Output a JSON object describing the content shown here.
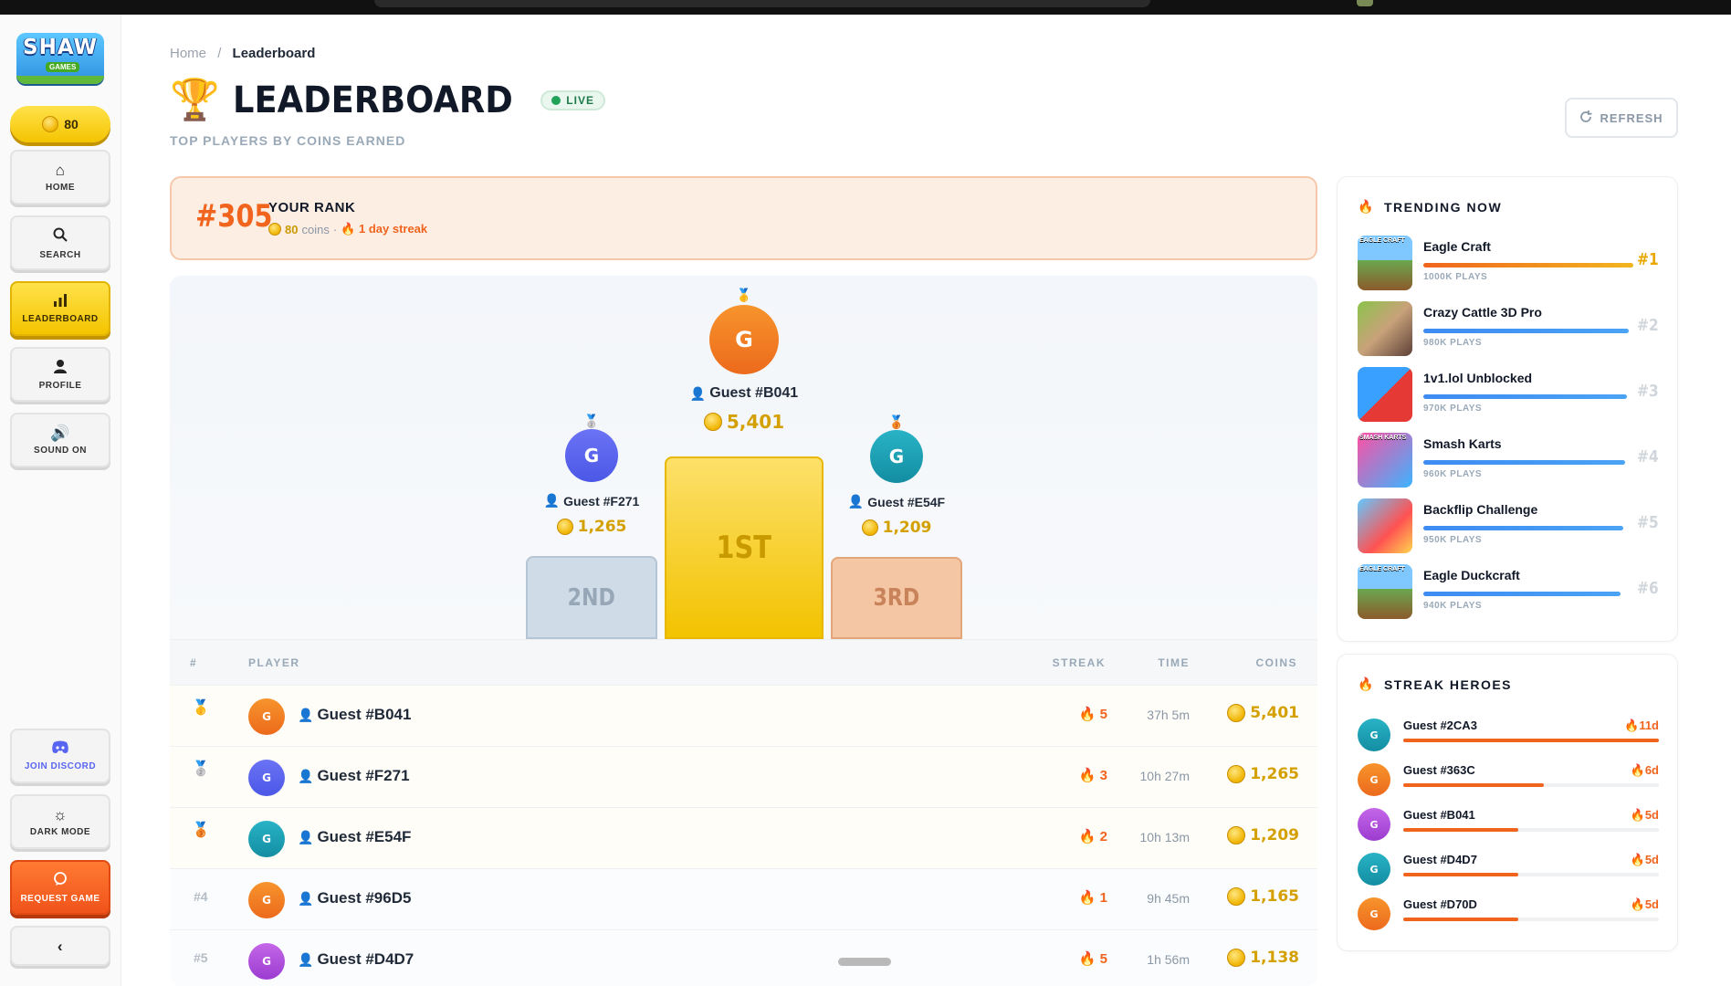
{
  "app": {
    "logo_text": "SHAW",
    "logo_sub": "GAMES",
    "coins": "80"
  },
  "sidebar": {
    "items": [
      {
        "label": "HOME",
        "icon": "home-icon"
      },
      {
        "label": "SEARCH",
        "icon": "search-icon"
      },
      {
        "label": "LEADERBOARD",
        "icon": "bar-chart-icon",
        "active": true
      },
      {
        "label": "PROFILE",
        "icon": "user-icon"
      },
      {
        "label": "SOUND ON",
        "icon": "speaker-icon"
      }
    ],
    "bottom": [
      {
        "label": "JOIN DISCORD",
        "icon": "discord-icon"
      },
      {
        "label": "DARK MODE",
        "icon": "sun-icon"
      },
      {
        "label": "REQUEST GAME",
        "icon": "chat-icon"
      }
    ],
    "collapse_glyph": "‹"
  },
  "breadcrumb": {
    "home": "Home",
    "separator": "/",
    "current": "Leaderboard"
  },
  "header": {
    "title": "LEADERBOARD",
    "live": "LIVE",
    "subtitle": "TOP PLAYERS BY COINS EARNED",
    "refresh": "REFRESH"
  },
  "your_rank": {
    "rank": "#305",
    "label": "YOUR RANK",
    "coins": "80",
    "coins_suffix": "coins",
    "separator": "·",
    "streak": "1 day streak"
  },
  "podium": {
    "first": {
      "initial": "G",
      "name": "Guest #B041",
      "coins": "5,401",
      "place": "1ST"
    },
    "second": {
      "initial": "G",
      "name": "Guest #F271",
      "coins": "1,265",
      "place": "2ND"
    },
    "third": {
      "initial": "G",
      "name": "Guest #E54F",
      "coins": "1,209",
      "place": "3RD"
    }
  },
  "table": {
    "headers": {
      "rank": "#",
      "player": "PLAYER",
      "streak": "STREAK",
      "time": "TIME",
      "coins": "COINS"
    },
    "rows": [
      {
        "rank": "1",
        "initial": "G",
        "name": "Guest #B041",
        "streak": "5",
        "time": "37h 5m",
        "coins": "5,401"
      },
      {
        "rank": "2",
        "initial": "G",
        "name": "Guest #F271",
        "streak": "3",
        "time": "10h 27m",
        "coins": "1,265"
      },
      {
        "rank": "3",
        "initial": "G",
        "name": "Guest #E54F",
        "streak": "2",
        "time": "10h 13m",
        "coins": "1,209"
      },
      {
        "rank": "#4",
        "initial": "G",
        "name": "Guest #96D5",
        "streak": "1",
        "time": "9h 45m",
        "coins": "1,165"
      },
      {
        "rank": "#5",
        "initial": "G",
        "name": "Guest #D4D7",
        "streak": "5",
        "time": "1h 56m",
        "coins": "1,138"
      }
    ]
  },
  "trending": {
    "title": "TRENDING NOW",
    "items": [
      {
        "name": "Eagle Craft",
        "plays": "1000K PLAYS",
        "rank": "#1",
        "share": 1.0,
        "thumb_label": "EAGLE CRAFT"
      },
      {
        "name": "Crazy Cattle 3D Pro",
        "plays": "980K PLAYS",
        "rank": "#2",
        "share": 0.98,
        "thumb_label": ""
      },
      {
        "name": "1v1.lol Unblocked",
        "plays": "970K PLAYS",
        "rank": "#3",
        "share": 0.97,
        "thumb_label": ""
      },
      {
        "name": "Smash Karts",
        "plays": "960K PLAYS",
        "rank": "#4",
        "share": 0.96,
        "thumb_label": "SMASH KARTS"
      },
      {
        "name": "Backflip Challenge",
        "plays": "950K PLAYS",
        "rank": "#5",
        "share": 0.95,
        "thumb_label": ""
      },
      {
        "name": "Eagle Duckcraft",
        "plays": "940K PLAYS",
        "rank": "#6",
        "share": 0.94,
        "thumb_label": "EAGLE CRAFT"
      }
    ]
  },
  "streak_heroes": {
    "title": "STREAK HEROES",
    "items": [
      {
        "initial": "G",
        "name": "Guest #2CA3",
        "days": "11d",
        "share": 1.0
      },
      {
        "initial": "G",
        "name": "Guest #363C",
        "days": "6d",
        "share": 0.55
      },
      {
        "initial": "G",
        "name": "Guest #B041",
        "days": "5d",
        "share": 0.45
      },
      {
        "initial": "G",
        "name": "Guest #D4D7",
        "days": "5d",
        "share": 0.45
      },
      {
        "initial": "G",
        "name": "Guest #D70D",
        "days": "5d",
        "share": 0.45
      }
    ]
  },
  "colors": {
    "accent_orange": "#f0641e",
    "gold": "#f4c400",
    "live_green": "#22a35a"
  }
}
